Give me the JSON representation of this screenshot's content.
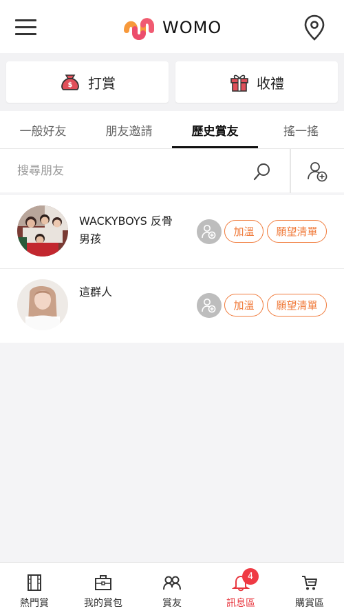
{
  "header": {
    "brand": "WOMO"
  },
  "actions": {
    "tip_label": "打賞",
    "gift_label": "收禮"
  },
  "tabs": [
    {
      "label": "一般好友",
      "active": false
    },
    {
      "label": "朋友邀請",
      "active": false
    },
    {
      "label": "歷史賞友",
      "active": true
    },
    {
      "label": "搖一搖",
      "active": false
    }
  ],
  "search": {
    "placeholder": "搜尋朋友",
    "value": ""
  },
  "friends": [
    {
      "name": "WACKYBOYS 反骨\n男孩",
      "follow_label": "加溫",
      "wishlist_label": "願望清單"
    },
    {
      "name": "這群人",
      "follow_label": "加溫",
      "wishlist_label": "願望清單"
    }
  ],
  "bottom_nav": [
    {
      "label": "熱門賞",
      "icon": "film-icon",
      "active": false
    },
    {
      "label": "我的賞包",
      "icon": "briefcase-icon",
      "active": false
    },
    {
      "label": "賞友",
      "icon": "friends-icon",
      "active": false
    },
    {
      "label": "訊息區",
      "icon": "bell-icon",
      "active": true,
      "badge": "4"
    },
    {
      "label": "購賞區",
      "icon": "cart-icon",
      "active": false
    }
  ],
  "colors": {
    "accent": "#f07a3a",
    "active_nav": "#e8373f",
    "badge": "#ef3a44"
  }
}
